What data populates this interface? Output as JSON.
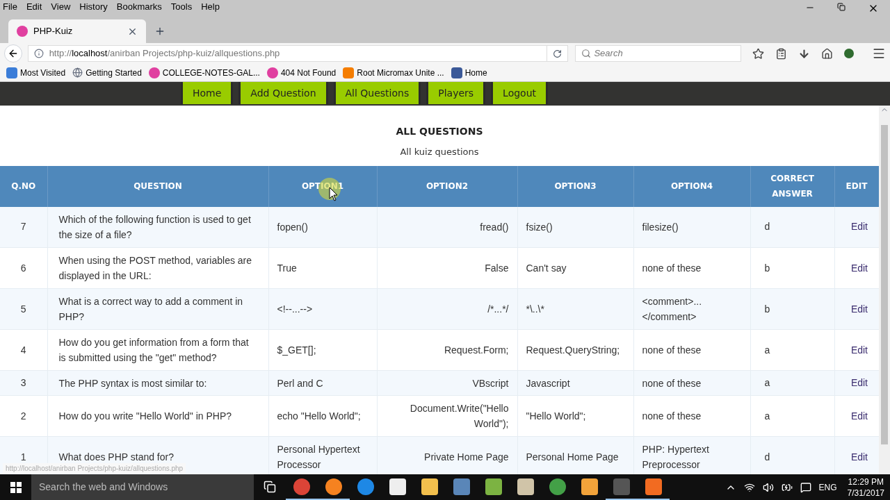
{
  "menu_bar": [
    "File",
    "Edit",
    "View",
    "History",
    "Bookmarks",
    "Tools",
    "Help"
  ],
  "tabs": [
    {
      "title": "PHP-Kuiz",
      "selected": true
    }
  ],
  "address_bar": {
    "scheme": "http://",
    "host": "localhost",
    "path": "/anirban Projects/php-kuiz/allquestions.php"
  },
  "search": {
    "placeholder": "Search"
  },
  "bookmarks": [
    {
      "label": "Most Visited",
      "kind": "star"
    },
    {
      "label": "Getting Started",
      "kind": "globe"
    },
    {
      "label": "COLLEGE-NOTES-GAL...",
      "kind": "w"
    },
    {
      "label": "404 Not Found",
      "kind": "w"
    },
    {
      "label": "Root Micromax Unite ...",
      "kind": "blogger"
    },
    {
      "label": "Home",
      "kind": "facebook"
    }
  ],
  "nav": [
    {
      "label": "Home"
    },
    {
      "label": "Add Question"
    },
    {
      "label": "All Questions"
    },
    {
      "label": "Players"
    },
    {
      "label": "Logout"
    }
  ],
  "page": {
    "title": "ALL QUESTIONS",
    "subtitle": "All kuiz questions"
  },
  "table": {
    "columns": [
      "Q.NO",
      "QUESTION",
      "OPTION1",
      "OPTION2",
      "OPTION3",
      "OPTION4",
      "CORRECT ANSWER",
      "EDIT"
    ],
    "rows": [
      {
        "no": "7",
        "question": "Which of the following function is used to get the size of a file?",
        "options": [
          "fopen()",
          "fread()",
          "fsize()",
          "filesize()"
        ],
        "answer": "d",
        "edit": "Edit"
      },
      {
        "no": "6",
        "question": "When using the POST method, variables are displayed in the URL:",
        "options": [
          "True",
          "False",
          "Can't say",
          "none of these"
        ],
        "answer": "b",
        "edit": "Edit"
      },
      {
        "no": "5",
        "question": "What is a correct way to add a comment in PHP?",
        "options": [
          "<!--...-->",
          "/*...*/",
          "*\\..\\*",
          "<comment>...</comment>"
        ],
        "answer": "b",
        "edit": "Edit"
      },
      {
        "no": "4",
        "question": "How do you get information from a form that is submitted using the \"get\" method?",
        "options": [
          "$_GET[];",
          "Request.Form;",
          "Request.QueryString;",
          "none of these"
        ],
        "answer": "a",
        "edit": "Edit"
      },
      {
        "no": "3",
        "question": "The PHP syntax is most similar to:",
        "options": [
          "Perl and C",
          "VBscript",
          "Javascript",
          "none of these"
        ],
        "answer": "a",
        "edit": "Edit"
      },
      {
        "no": "2",
        "question": "How do you write \"Hello World\" in PHP?",
        "options": [
          "echo \"Hello World\";",
          "Document.Write(\"Hello World\");",
          "\"Hello World\";",
          "none of these"
        ],
        "answer": "a",
        "edit": "Edit"
      },
      {
        "no": "1",
        "question": "What does PHP stand for?",
        "options": [
          "Personal Hypertext Processor",
          "Private Home Page",
          "Personal Home Page",
          "PHP: Hypertext Preprocessor"
        ],
        "answer": "d",
        "edit": "Edit"
      }
    ]
  },
  "status_url": "http://localhost/anirban Projects/php-kuiz/allquestions.php",
  "taskbar": {
    "search_placeholder": "Search the web and Windows",
    "apps": [
      {
        "kind": "taskview",
        "open": false
      },
      {
        "kind": "chrome",
        "open": true
      },
      {
        "kind": "firefox",
        "open": true
      },
      {
        "kind": "edge",
        "open": false
      },
      {
        "kind": "store",
        "open": false
      },
      {
        "kind": "folder",
        "open": false
      },
      {
        "kind": "media",
        "open": false
      },
      {
        "kind": "notepad",
        "open": false
      },
      {
        "kind": "paint",
        "open": false
      },
      {
        "kind": "download",
        "open": false
      },
      {
        "kind": "player",
        "open": false
      },
      {
        "kind": "sublime",
        "open": true
      },
      {
        "kind": "recorder",
        "open": true
      }
    ],
    "language": "ENG",
    "time": "12:29 PM",
    "date": "7/31/2017"
  }
}
